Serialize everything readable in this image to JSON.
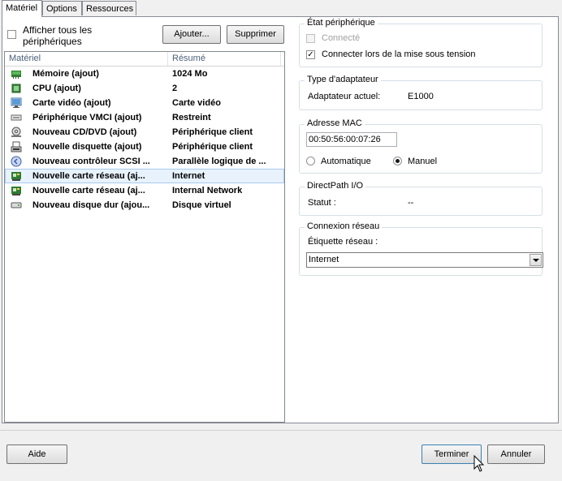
{
  "tabs": [
    {
      "label": "Matériel",
      "active": true
    },
    {
      "label": "Options",
      "active": false
    },
    {
      "label": "Ressources",
      "active": false
    }
  ],
  "show_all": {
    "label_line1": "Afficher tous les",
    "label_line2": "périphériques",
    "checked": false
  },
  "buttons": {
    "add": "Ajouter...",
    "remove": "Supprimer",
    "help": "Aide",
    "finish": "Terminer",
    "cancel": "Annuler"
  },
  "list": {
    "columns": [
      "Matériel",
      "Résumé"
    ],
    "rows": [
      {
        "name": "Mémoire (ajout)",
        "summary": "1024 Mo",
        "icon": "memory-icon",
        "selected": false
      },
      {
        "name": "CPU (ajout)",
        "summary": "2",
        "icon": "cpu-icon",
        "selected": false
      },
      {
        "name": "Carte vidéo  (ajout)",
        "summary": "Carte vidéo",
        "icon": "monitor-icon",
        "selected": false
      },
      {
        "name": "Périphérique VMCI (ajout)",
        "summary": "Restreint",
        "icon": "vmci-device-icon",
        "selected": false
      },
      {
        "name": "Nouveau CD/DVD (ajout)",
        "summary": "Périphérique client",
        "icon": "cd-dvd-icon",
        "selected": false
      },
      {
        "name": "Nouvelle disquette (ajout)",
        "summary": "Périphérique client",
        "icon": "floppy-icon",
        "selected": false
      },
      {
        "name": "Nouveau contrôleur SCSI ...",
        "summary": "Parallèle logique de ...",
        "icon": "scsi-controller-icon",
        "selected": false
      },
      {
        "name": "Nouvelle carte réseau (aj...",
        "summary": "Internet",
        "icon": "network-card-icon",
        "selected": true
      },
      {
        "name": "Nouvelle carte réseau (aj...",
        "summary": "Internal Network",
        "icon": "network-card-icon",
        "selected": false
      },
      {
        "name": "Nouveau disque dur (ajou...",
        "summary": "Disque virtuel",
        "icon": "hard-disk-icon",
        "selected": false
      }
    ]
  },
  "device_status": {
    "title": "État périphérique",
    "connected": {
      "label": "Connecté",
      "checked": false,
      "disabled": true
    },
    "connect_at_power_on": {
      "label": "Connecter lors de la mise sous tension",
      "checked": true
    }
  },
  "adapter_type": {
    "title": "Type d'adaptateur",
    "current_label": "Adaptateur actuel:",
    "current_value": "E1000"
  },
  "mac_address": {
    "title": "Adresse MAC",
    "value": "00:50:56:00:07:26",
    "automatic_label": "Automatique",
    "manual_label": "Manuel",
    "selected": "manual"
  },
  "directpath": {
    "title": "DirectPath I/O",
    "status_label": "Statut :",
    "status_value": "--"
  },
  "network_connection": {
    "title": "Connexion réseau",
    "label_label": "Étiquette réseau :",
    "selected": "Internet"
  }
}
